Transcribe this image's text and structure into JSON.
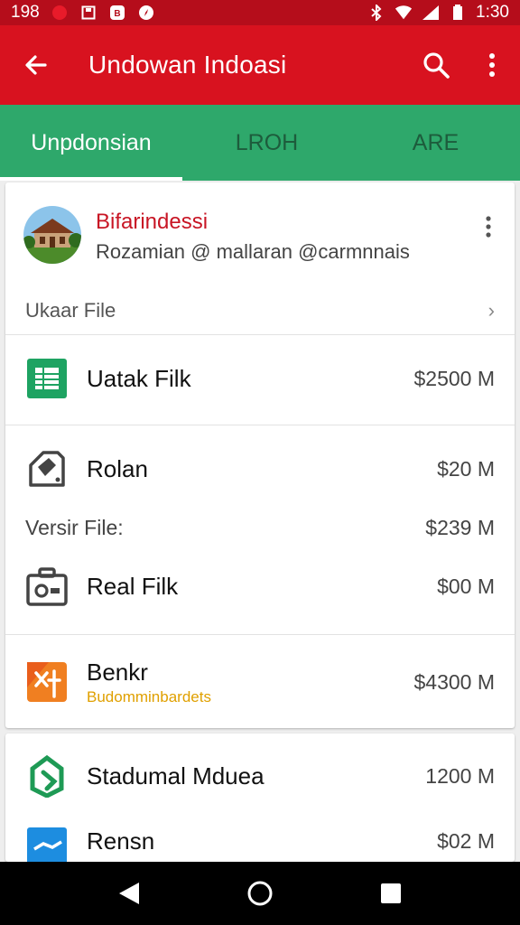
{
  "status": {
    "time_left": "198",
    "time_right": "1:30"
  },
  "app_bar": {
    "title": "Undowan Indoasi"
  },
  "tabs": [
    {
      "label": "Unpdonsian"
    },
    {
      "label": "LROH"
    },
    {
      "label": "ARE"
    }
  ],
  "account": {
    "name": "Bifarindessi",
    "email": "Rozamian @ mallaran @carmnnais"
  },
  "section": {
    "label": "Ukaar File",
    "chevron": "›"
  },
  "items": [
    {
      "name": "Uatak Filk",
      "value": "$2500 M",
      "icon": "spreadsheet-icon"
    },
    {
      "name": "Rolan",
      "value": "$20 M",
      "icon": "tag-icon"
    },
    {
      "name": "Real Filk",
      "value": "$00 M",
      "icon": "briefcase-icon"
    },
    {
      "name": "Benkr",
      "sub": "Budomminbardets",
      "value": "$4300 M",
      "icon": "orange-app-icon"
    },
    {
      "name": "Stadumal Mduea",
      "value": "1200 M",
      "icon": "green-app-icon"
    },
    {
      "name": "Rensn",
      "value": "$02 M",
      "icon": "blue-app-icon"
    }
  ],
  "version_row": {
    "label": "Versir File:",
    "value": "$239 M"
  },
  "colors": {
    "status_bar": "#b50d1b",
    "app_bar": "#d8121f",
    "tab_bar": "#2ea86b",
    "accent_red": "#c81524"
  }
}
